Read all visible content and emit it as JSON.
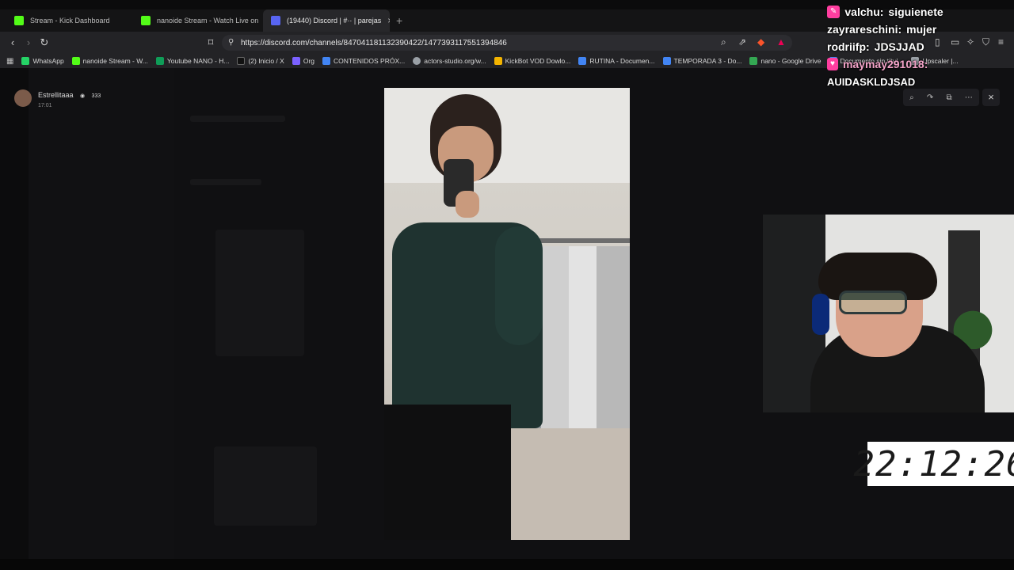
{
  "tabs": [
    {
      "label": "Stream - Kick Dashboard",
      "favicon_color": "#53fc18"
    },
    {
      "label": "nanoide Stream - Watch Live on",
      "favicon_color": "#53fc18"
    },
    {
      "label": "(19440) Discord | #·· | parejas",
      "favicon_color": "#5865f2"
    }
  ],
  "toolbar": {
    "url": "https://discord.com/channels/847041181132390422/1477393117551394846"
  },
  "bookmarks": [
    {
      "label": "WhatsApp",
      "color": "#25d366"
    },
    {
      "label": "nanoide Stream - W...",
      "color": "#53fc18"
    },
    {
      "label": "Youtube NANO - H...",
      "color": "#0f9d58"
    },
    {
      "label": "(2) Inicio / X",
      "color": "#111111"
    },
    {
      "label": "Org",
      "color": "#7b61ff"
    },
    {
      "label": "CONTENIDOS PRÓX...",
      "color": "#4285f4"
    },
    {
      "label": "actors-studio.org/w...",
      "color": "#9aa0a6"
    },
    {
      "label": "KickBot VOD Dowlo...",
      "color": "#f4b400"
    },
    {
      "label": "RUTINA - Documen...",
      "color": "#4285f4"
    },
    {
      "label": "TEMPORADA 3 - Do...",
      "color": "#4285f4"
    },
    {
      "label": "nano - Google Drive",
      "color": "#34a853"
    },
    {
      "label": "Documento sin títul...",
      "color": "#4285f4"
    },
    {
      "label": "Upscaler |...",
      "color": "#9aa0a6"
    }
  ],
  "viewer": {
    "username": "Estrellitaaa",
    "badge": "333",
    "time": "17:01"
  },
  "chat": [
    {
      "user": "valchu:",
      "text": "siguienete"
    },
    {
      "user": "zayrareschini:",
      "text": "mujer"
    },
    {
      "user": "rodriifp:",
      "text": "JDSJJAD"
    },
    {
      "user": "maymay291018:",
      "text": ""
    },
    {
      "user": "",
      "text": "AUIDASKLDJSAD"
    }
  ],
  "clock": "22:12:26"
}
